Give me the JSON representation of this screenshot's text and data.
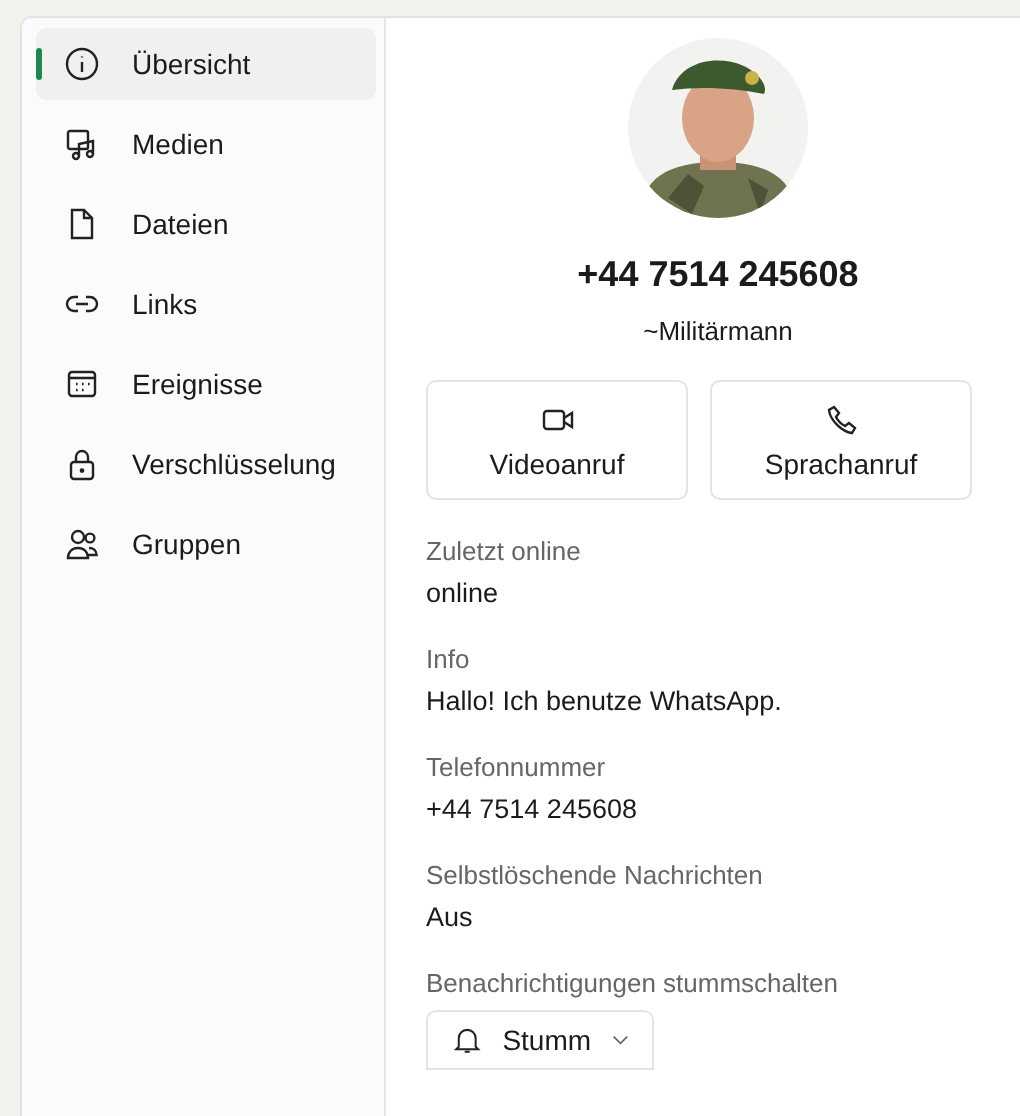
{
  "sidebar": {
    "items": [
      {
        "label": "Übersicht",
        "selected": true
      },
      {
        "label": "Medien",
        "selected": false
      },
      {
        "label": "Dateien",
        "selected": false
      },
      {
        "label": "Links",
        "selected": false
      },
      {
        "label": "Ereignisse",
        "selected": false
      },
      {
        "label": "Verschlüsselung",
        "selected": false
      },
      {
        "label": "Gruppen",
        "selected": false
      }
    ]
  },
  "profile": {
    "phone": "+44 7514 245608",
    "name": "~Militärmann"
  },
  "actions": [
    {
      "label": "Videoanruf",
      "kind": "video"
    },
    {
      "label": "Sprachanruf",
      "kind": "voice"
    }
  ],
  "fields": [
    {
      "label": "Zuletzt online",
      "value": "online"
    },
    {
      "label": "Info",
      "value": "Hallo! Ich benutze WhatsApp."
    },
    {
      "label": "Telefonnummer",
      "value": "+44 7514 245608"
    },
    {
      "label": "Selbstlöschende Nachrichten",
      "value": "Aus"
    }
  ],
  "mute": {
    "label": "Benachrichtigungen stummschalten",
    "value": "Stumm"
  }
}
